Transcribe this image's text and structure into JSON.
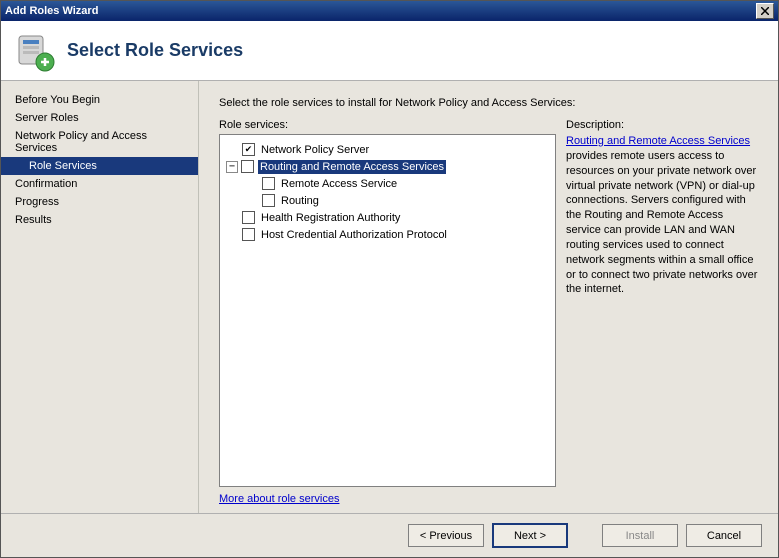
{
  "window": {
    "title": "Add Roles Wizard"
  },
  "header": {
    "title": "Select Role Services"
  },
  "sidebar": {
    "steps": [
      {
        "label": "Before You Begin"
      },
      {
        "label": "Server Roles"
      },
      {
        "label": "Network Policy and Access Services"
      },
      {
        "label": "Role Services"
      },
      {
        "label": "Confirmation"
      },
      {
        "label": "Progress"
      },
      {
        "label": "Results"
      }
    ]
  },
  "content": {
    "instruction": "Select the role services to install for Network Policy and Access Services:",
    "role_services_label": "Role services:",
    "description_label": "Description:",
    "more_link": "More about role services",
    "tree": {
      "nps": "Network Policy Server",
      "rras": "Routing and Remote Access Services",
      "ras": "Remote Access Service",
      "routing": "Routing",
      "hra": "Health Registration Authority",
      "hcap": "Host Credential Authorization Protocol"
    },
    "description": {
      "link": "Routing and Remote Access Services",
      "text": " provides remote users access to resources on your private network over virtual private network (VPN) or dial-up connections. Servers configured with the Routing and Remote Access service can provide LAN and WAN routing services used to connect network segments within a small office or to connect two private networks over the internet."
    }
  },
  "footer": {
    "previous": "< Previous",
    "next": "Next >",
    "install": "Install",
    "cancel": "Cancel"
  }
}
